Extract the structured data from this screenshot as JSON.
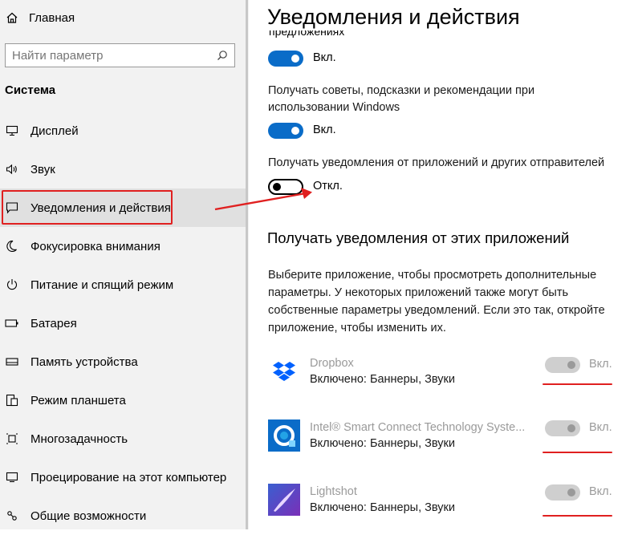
{
  "sidebar": {
    "home_label": "Главная",
    "search_placeholder": "Найти параметр",
    "section": "Система",
    "items": [
      {
        "label": "Дисплей",
        "icon": "display-icon"
      },
      {
        "label": "Звук",
        "icon": "speaker-icon"
      },
      {
        "label": "Уведомления и действия",
        "icon": "notification-icon",
        "selected": true
      },
      {
        "label": "Фокусировка внимания",
        "icon": "moon-icon"
      },
      {
        "label": "Питание и спящий режим",
        "icon": "power-icon"
      },
      {
        "label": "Батарея",
        "icon": "battery-icon"
      },
      {
        "label": "Память устройства",
        "icon": "storage-icon"
      },
      {
        "label": "Режим планшета",
        "icon": "tablet-icon"
      },
      {
        "label": "Многозадачность",
        "icon": "multitask-icon"
      },
      {
        "label": "Проецирование на этот компьютер",
        "icon": "project-icon"
      },
      {
        "label": "Общие возможности",
        "icon": "share-icon"
      }
    ]
  },
  "main": {
    "title": "Уведомления и действия",
    "cut_text": "предложениях",
    "settings": [
      {
        "text": "",
        "toggle": "Вкл.",
        "on": true
      },
      {
        "text": "Получать советы, подсказки и рекомендации при использовании Windows",
        "toggle": "Вкл.",
        "on": true
      },
      {
        "text": "Получать уведомления от приложений и других отправителей",
        "toggle": "Откл.",
        "on": false
      }
    ],
    "apps_heading": "Получать уведомления от этих приложений",
    "apps_description": "Выберите приложение, чтобы просмотреть дополнительные параметры. У некоторых приложений также могут быть собственные параметры уведомлений. Если это так, откройте приложение, чтобы изменить их.",
    "apps": [
      {
        "name": "Dropbox",
        "status": "Включено: Баннеры, Звуки",
        "toggle": "Вкл.",
        "icon": "dropbox-icon"
      },
      {
        "name": "Intel® Smart Connect Technology Syste...",
        "status": "Включено: Баннеры, Звуки",
        "toggle": "Вкл.",
        "icon": "intel-icon"
      },
      {
        "name": "Lightshot",
        "status": "Включено: Баннеры, Звуки",
        "toggle": "Вкл.",
        "icon": "lightshot-icon"
      }
    ]
  },
  "colors": {
    "accent": "#0a6cc8",
    "annotation": "#e02020",
    "sidebar_bg": "#f2f2f2"
  }
}
